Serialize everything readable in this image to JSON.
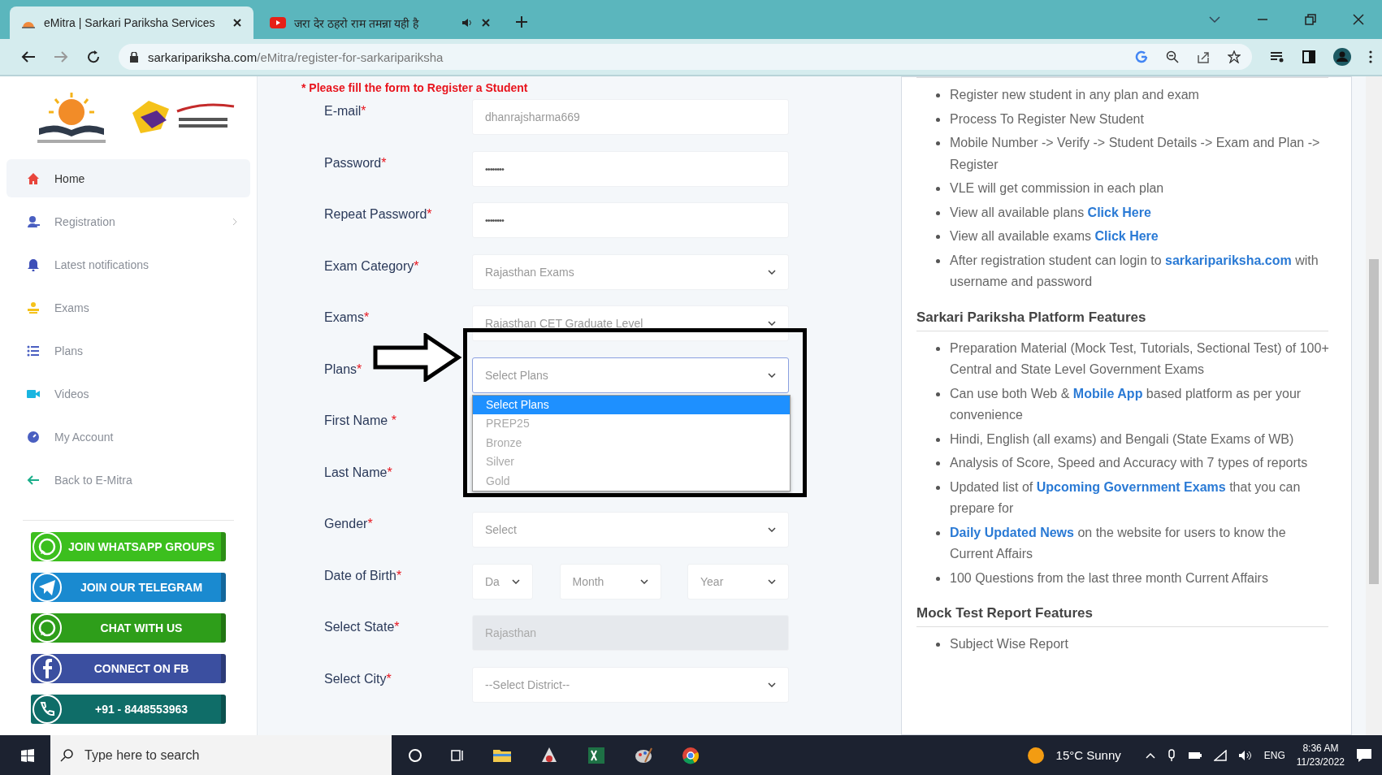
{
  "browser": {
    "tabs": [
      {
        "title": "eMitra | Sarkari Pariksha Services",
        "selected": true,
        "kind": "site"
      },
      {
        "title": "जरा देर ठहरो राम तमन्ना यही है",
        "selected": false,
        "kind": "video"
      }
    ],
    "address": {
      "domain": "sarkaripariksha.com",
      "path": "/eMitra/register-for-sarkaripariksha"
    }
  },
  "sidebar": {
    "items": [
      {
        "label": "Home",
        "selected": true,
        "expandable": false
      },
      {
        "label": "Registration",
        "selected": false,
        "expandable": true
      },
      {
        "label": "Latest notifications",
        "selected": false,
        "expandable": false
      },
      {
        "label": "Exams",
        "selected": false,
        "expandable": false
      },
      {
        "label": "Plans",
        "selected": false,
        "expandable": false
      },
      {
        "label": "Videos",
        "selected": false,
        "expandable": false
      },
      {
        "label": "My Account",
        "selected": false,
        "expandable": false
      },
      {
        "label": "Back to E-Mitra",
        "selected": false,
        "expandable": false
      }
    ],
    "banners": [
      {
        "label": "JOIN WHATSAPP GROUPS",
        "kind": "whatsapp",
        "color": "#3cbf1e"
      },
      {
        "label": "JOIN OUR TELEGRAM",
        "kind": "telegram",
        "color": "#1a8ad0"
      },
      {
        "label": "CHAT WITH US",
        "kind": "whatsapp",
        "color": "#2e9e1a"
      },
      {
        "label": "CONNECT ON FB",
        "kind": "facebook",
        "color": "#3b4fa0"
      },
      {
        "label": "+91 - 8448553963",
        "kind": "phone",
        "color": "#0f6d68"
      }
    ]
  },
  "form": {
    "notice": "* Please fill the form to Register a Student",
    "fields": [
      {
        "label": "E-mail",
        "required": "*",
        "kind": "text",
        "value": "dhanrajsharma669"
      },
      {
        "label": "Password",
        "required": "*",
        "kind": "password",
        "value": "••••••••"
      },
      {
        "label": "Repeat Password",
        "required": "*",
        "kind": "password",
        "value": "••••••••"
      },
      {
        "label": "Exam Category",
        "required": "*",
        "kind": "select",
        "value": "Rajasthan Exams"
      },
      {
        "label": "Exams",
        "required": "*",
        "kind": "select",
        "value": "Rajasthan CET Graduate Level"
      },
      {
        "label": "Plans",
        "required": "*",
        "kind": "dropdown",
        "value": "Select Plans",
        "options": [
          {
            "label": "Select Plans",
            "selected": true
          },
          {
            "label": "PREP25",
            "selected": false
          },
          {
            "label": "Bronze",
            "selected": false
          },
          {
            "label": "Silver",
            "selected": false
          },
          {
            "label": "Gold",
            "selected": false
          }
        ]
      },
      {
        "label": "First Name ",
        "required": "*",
        "kind": "hidden"
      },
      {
        "label": "Last Name",
        "required": "*",
        "kind": "hidden"
      },
      {
        "label": "Gender",
        "required": "*",
        "kind": "select",
        "value": "Select"
      },
      {
        "label": "Date of Birth",
        "required": "*",
        "kind": "date",
        "parts": [
          "Da",
          "Month",
          "Year"
        ]
      },
      {
        "label": "Select State",
        "required": "*",
        "kind": "disabled",
        "value": "Rajasthan"
      },
      {
        "label": "Select City",
        "required": "*",
        "kind": "select",
        "value": "--Select District--"
      }
    ]
  },
  "info": {
    "sections": [
      {
        "items": [
          [
            {
              "text": "Register new student in any plan and exam"
            }
          ],
          [
            {
              "text": "Process To Register New Student"
            }
          ],
          [
            {
              "text": "Mobile Number -> Verify -> Student Details -> Exam and Plan -> Register"
            }
          ],
          [
            {
              "text": "VLE will get commission in each plan"
            }
          ],
          [
            {
              "text": "View all available plans "
            },
            {
              "text": "Click Here",
              "link": true
            }
          ],
          [
            {
              "text": "View all available exams "
            },
            {
              "text": "Click Here",
              "link": true
            }
          ],
          [
            {
              "text": "After registration student can login to "
            },
            {
              "text": "sarkaripariksha.com",
              "link": true
            },
            {
              "text": " with username and password"
            }
          ]
        ]
      },
      {
        "heading": "Sarkari Pariksha Platform Features",
        "items": [
          [
            {
              "text": "Preparation Material (Mock Test, Tutorials, Sectional Test) of 100+ Central and State Level Government Exams"
            }
          ],
          [
            {
              "text": "Can use both Web & "
            },
            {
              "text": "Mobile App",
              "link": true
            },
            {
              "text": " based platform as per your convenience"
            }
          ],
          [
            {
              "text": "Hindi, English (all exams) and Bengali (State Exams of WB)"
            }
          ],
          [
            {
              "text": "Analysis of Score, Speed and Accuracy with 7 types of reports"
            }
          ],
          [
            {
              "text": "Updated list of "
            },
            {
              "text": "Upcoming Government Exams",
              "link": true
            },
            {
              "text": " that you can prepare for"
            }
          ],
          [
            {
              "text": "Daily Updated News",
              "link": true
            },
            {
              "text": " on the website for users to know the Current Affairs"
            }
          ],
          [
            {
              "text": "100 Questions from the last three month Current Affairs"
            }
          ]
        ]
      },
      {
        "heading": "Mock Test Report Features",
        "items": [
          [
            {
              "text": "Subject Wise Report"
            }
          ]
        ]
      }
    ]
  },
  "taskbar": {
    "search_placeholder": "Type here to search",
    "weather": "15°C Sunny",
    "language": "ENG",
    "time": "8:36 AM",
    "date": "11/23/2022"
  }
}
